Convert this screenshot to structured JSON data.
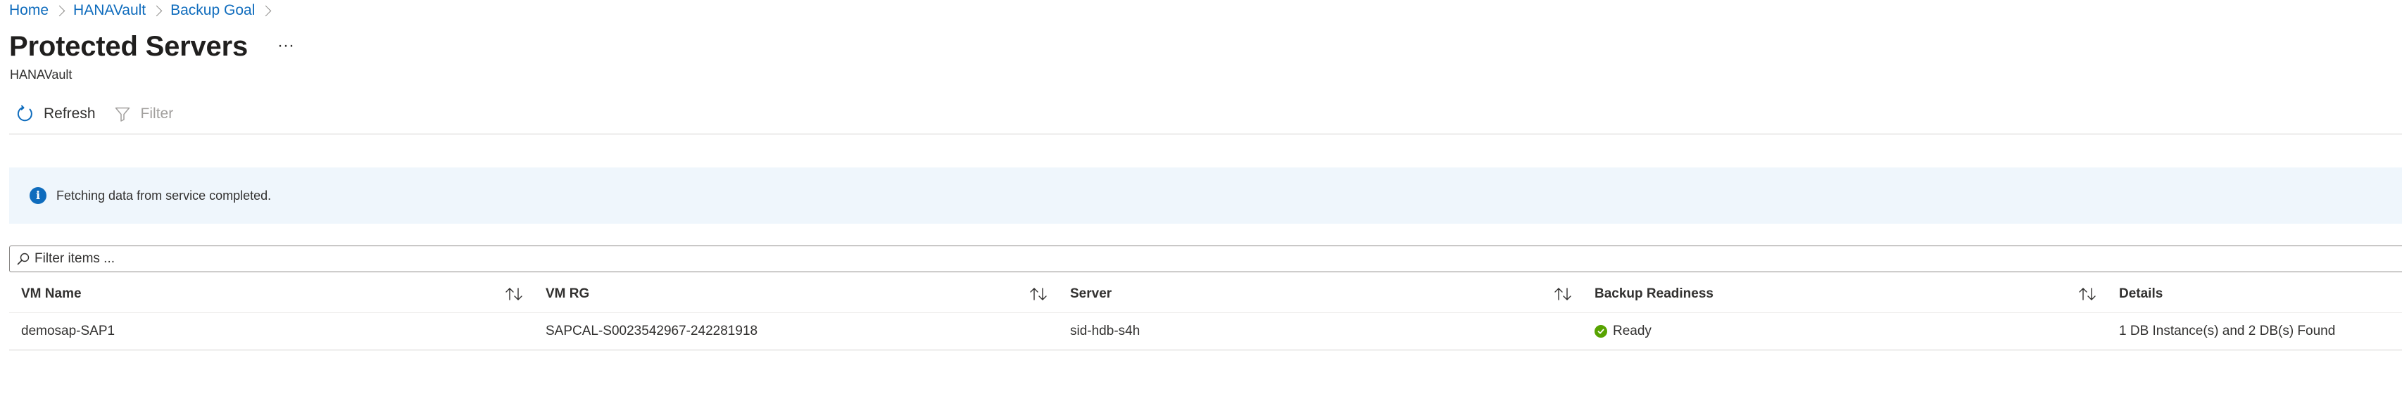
{
  "breadcrumb": {
    "items": [
      {
        "label": "Home"
      },
      {
        "label": "HANAVault"
      },
      {
        "label": "Backup Goal"
      }
    ]
  },
  "header": {
    "title": "Protected Servers",
    "more_label": "···",
    "subtitle": "HANAVault"
  },
  "toolbar": {
    "refresh_label": "Refresh",
    "filter_label": "Filter"
  },
  "infobar": {
    "message": "Fetching data from service completed.",
    "icon": "info-icon"
  },
  "filter": {
    "placeholder": "Filter items ..."
  },
  "table": {
    "columns": [
      {
        "label": "VM Name"
      },
      {
        "label": "VM RG"
      },
      {
        "label": "Server"
      },
      {
        "label": "Backup Readiness"
      },
      {
        "label": "Details"
      }
    ],
    "rows": [
      {
        "vm_name": "demosap-SAP1",
        "vm_rg": "SAPCAL-S0023542967-242281918",
        "server": "sid-hdb-s4h",
        "backup_readiness": "Ready",
        "details": "1 DB Instance(s) and 2 DB(s) Found"
      }
    ]
  },
  "colors": {
    "link": "#0f6cbd",
    "info_bg": "#eff6fc",
    "ready": "#57a300"
  }
}
